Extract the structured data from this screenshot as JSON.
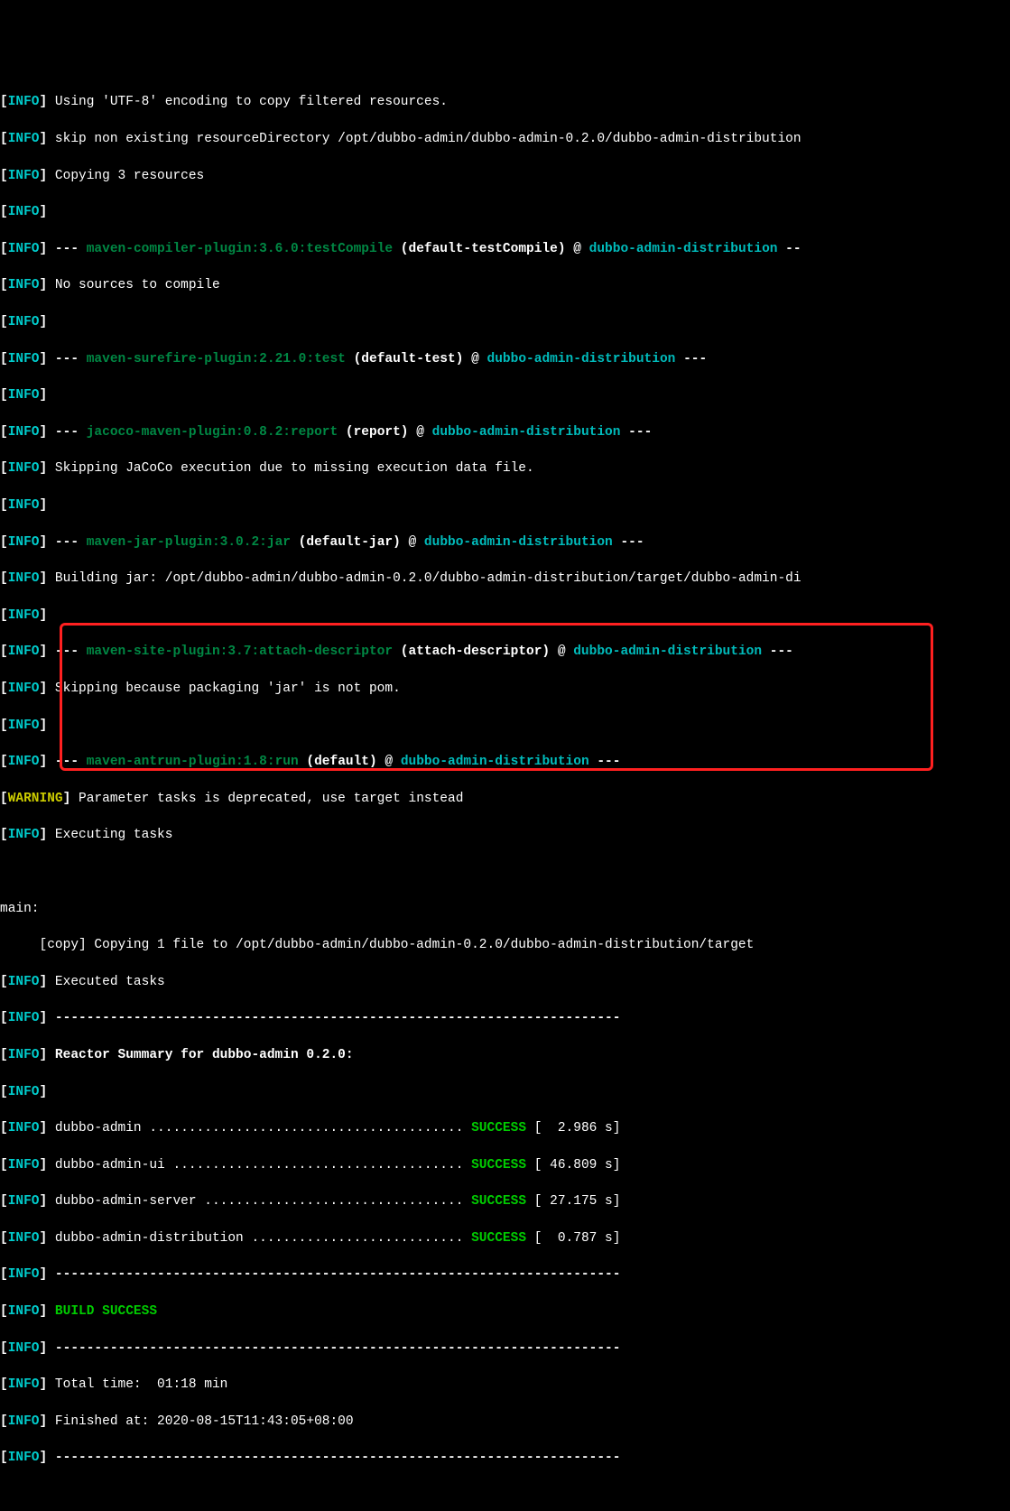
{
  "levels": {
    "info": "INFO",
    "warning": "WARNING"
  },
  "text": {
    "l1": "Using 'UTF-8' encoding to copy filtered resources.",
    "l2": "skip non existing resourceDirectory /opt/dubbo-admin/dubbo-admin-0.2.0/dubbo-admin-distribution",
    "l3": "Copying 3 resources",
    "l5": "--- ",
    "l5p": "maven-compiler-plugin:3.6.0:testCompile",
    "l5b": " (default-testCompile)",
    "l5at": " @ ",
    "l5m": "dubbo-admin-distribution",
    "l5e": " --",
    "l6": "No sources to compile",
    "l8p": "maven-surefire-plugin:2.21.0:test",
    "l8b": " (default-test)",
    "l8m": "dubbo-admin-distribution",
    "l8e": " ---",
    "l10p": "jacoco-maven-plugin:0.8.2:report",
    "l10b": " (report)",
    "l10m": "dubbo-admin-distribution",
    "l10e": " ---",
    "l11": "Skipping JaCoCo execution due to missing execution data file.",
    "l13p": "maven-jar-plugin:3.0.2:jar",
    "l13b": " (default-jar)",
    "l13m": "dubbo-admin-distribution",
    "l13e": " ---",
    "l14": "Building jar: /opt/dubbo-admin/dubbo-admin-0.2.0/dubbo-admin-distribution/target/dubbo-admin-di",
    "l16p": "maven-site-plugin:3.7:attach-descriptor",
    "l16b": " (attach-descriptor)",
    "l16m": "dubbo-admin-distribution",
    "l16e": " ---",
    "l17": "Skipping because packaging 'jar' is not pom.",
    "l19p": "maven-antrun-plugin:1.8:run",
    "l19b": " (default)",
    "l19m": "dubbo-admin-distribution",
    "l19e": " ---",
    "l20": "Parameter tasks is deprecated, use target instead",
    "l21": "Executing tasks",
    "l22": "main:",
    "l23": "     [copy] Copying 1 file to /opt/dubbo-admin/dubbo-admin-0.2.0/dubbo-admin-distribution/target",
    "l24": "Executed tasks",
    "sep": "------------------------------------------------------------------------",
    "l26": "Reactor Summary for dubbo-admin 0.2.0:",
    "r1n": "dubbo-admin ........................................ ",
    "r1s": "SUCCESS",
    "r1t": " [  2.986 s]",
    "r2n": "dubbo-admin-ui ..................................... ",
    "r2t": " [ 46.809 s]",
    "r3n": "dubbo-admin-server ................................. ",
    "r3t": " [ 27.175 s]",
    "r4n": "dubbo-admin-distribution ........................... ",
    "r4t": " [  0.787 s]",
    "build": "BUILD SUCCESS",
    "l34": "Total time:  01:18 min",
    "l35": "Finished at: 2020-08-15T11:43:05+08:00"
  }
}
